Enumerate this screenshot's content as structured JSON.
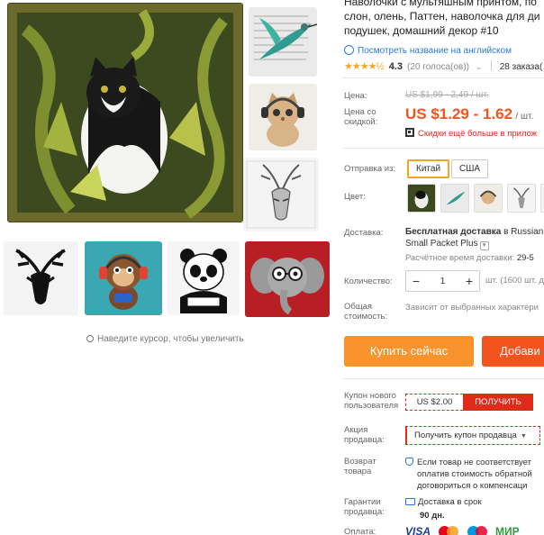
{
  "product": {
    "title_line1": "Наволочки с мультяшным принтом, по",
    "title_line2": "слон, олень, Паттен, наволочка для ди",
    "title_line3": "подушек, домашний декор #10",
    "translate_link": "Посмотреть название на английском",
    "rating": {
      "stars": "★★★★½",
      "value": "4.3",
      "votes": "(20 голоса(ов))",
      "orders": "28 заказа("
    }
  },
  "pricing": {
    "price_label": "Цена:",
    "old_price": "US $1,99 - 2,49 / шт.",
    "sale_label": "Цена со скидкой:",
    "sale_price": "US $1.29 - 1.62",
    "per_unit": "/ шт.",
    "app_promo": "Скидки ещё больше в прилож"
  },
  "shipping_from": {
    "label": "Отправка из:",
    "options": [
      "Китай",
      "США"
    ],
    "selected": "Китай"
  },
  "color": {
    "label": "Цвет:",
    "swatches": [
      "cat",
      "bird",
      "kitten",
      "deer",
      "deer-2"
    ]
  },
  "delivery": {
    "label": "Доставка:",
    "method_bold": "Бесплатная доставка",
    "method_rest": " в Russian",
    "method_line2": "Small Packet Plus",
    "dropdown_icon": "▾",
    "estimate_label": "Расчётное время доставки:",
    "estimate_value": "29-5"
  },
  "quantity": {
    "label": "Количество:",
    "minus": "−",
    "value": "1",
    "plus": "+",
    "note": "шт. (1600 шт. д"
  },
  "total": {
    "label": "Общая стоимость:",
    "note": "Зависит от выбранных характери"
  },
  "actions": {
    "buy_now": "Купить сейчас",
    "add_to_cart": "Добави"
  },
  "coupons": {
    "new_user_label": "Купон нового пользователя",
    "new_user_value": "US $2.00",
    "new_user_button": "ПОЛУЧИТЬ",
    "seller_label": "Акция продавца:",
    "seller_button": "Получить купон продавца",
    "seller_dropdown": "▼"
  },
  "returns": {
    "label": "Возврат товара",
    "line1": "Если товар не соответствует",
    "line2": "оплатив стоимость обратной",
    "line3": "договориться о компенсаци"
  },
  "guarantee": {
    "label": "Гарантии продавца:",
    "line1": "Доставка в срок",
    "line2": "90 дн."
  },
  "payment": {
    "label": "Оплата:",
    "visa": "VISA",
    "mir": "МИР"
  },
  "gallery": {
    "zoom_hint": "Наведите курсор, чтобы увеличить"
  },
  "colors": {
    "accent": "#f5531e",
    "buy": "#f8942b",
    "link": "#2a7ad8",
    "coupon": "#e02a1a",
    "star": "#f5a623"
  }
}
